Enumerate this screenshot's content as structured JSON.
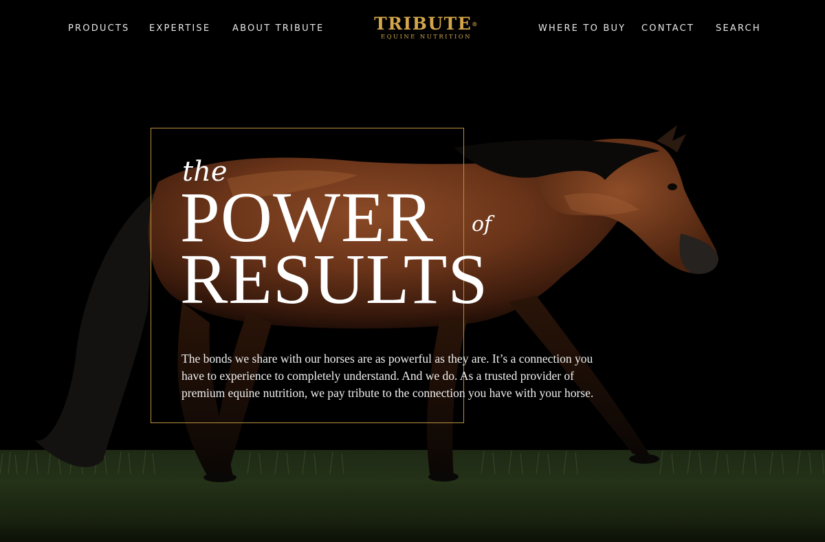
{
  "nav": {
    "left": [
      "PRODUCTS",
      "EXPERTISE",
      "ABOUT TRIBUTE"
    ],
    "right": [
      "WHERE TO BUY",
      "CONTACT",
      "SEARCH"
    ]
  },
  "logo": {
    "word": "TRIBUTE",
    "registered": "®",
    "subtitle": "EQUINE NUTRITION"
  },
  "hero": {
    "the": "the",
    "power": "POWER",
    "of": "of",
    "results": "RESULTS",
    "body": "The bonds we share with our horses are as powerful as they are. It’s a connection you have to experience to completely understand. And we do. As a trusted provider of premium equine nutrition, we pay tribute to the connection you have with your horse."
  },
  "colors": {
    "accent": "#d4a64a",
    "frame": "#b8913f",
    "background": "#000000"
  }
}
